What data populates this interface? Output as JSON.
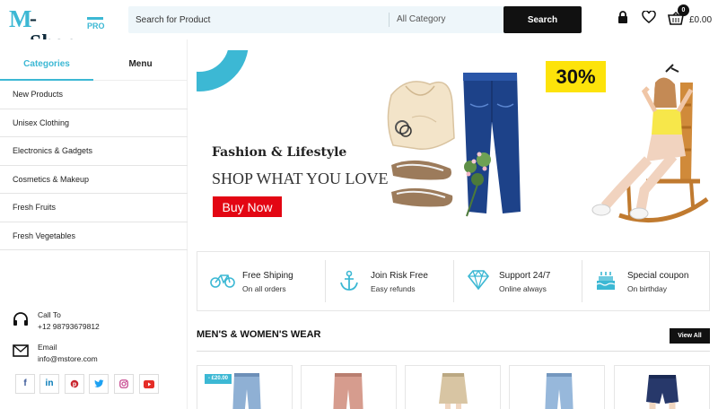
{
  "brand": {
    "logo_m": "M",
    "logo_shop": "-Shop",
    "logo_pro": "PRO"
  },
  "search": {
    "placeholder": "Search for Product",
    "category": "All Category",
    "button": "Search"
  },
  "header": {
    "cart_count": "0",
    "cart_total": "£0.00"
  },
  "sidebar": {
    "tabs": [
      {
        "label": "Categories"
      },
      {
        "label": "Menu"
      }
    ],
    "categories": [
      {
        "label": "New Products"
      },
      {
        "label": "Unisex Clothing"
      },
      {
        "label": "Electronics & Gadgets"
      },
      {
        "label": "Cosmetics & Makeup"
      },
      {
        "label": "Fresh Fruits"
      },
      {
        "label": "Fresh Vegetables"
      }
    ],
    "contact": {
      "call_title": "Call To",
      "call_value": "+12 98793679812",
      "email_title": "Email",
      "email_value": "info@mstore.com"
    },
    "socials": [
      "facebook",
      "linkedin",
      "pinterest",
      "twitter",
      "instagram",
      "youtube"
    ]
  },
  "banner": {
    "subtitle": "Fashion & Lifestyle",
    "title": "SHOP WHAT YOU LOVE",
    "button": "Buy Now",
    "side_badge": "30%"
  },
  "features": [
    {
      "icon": "bicycle-icon",
      "title": "Free Shiping",
      "sub": "On all orders"
    },
    {
      "icon": "anchor-icon",
      "title": "Join Risk Free",
      "sub": "Easy refunds"
    },
    {
      "icon": "diamond-icon",
      "title": "Support 24/7",
      "sub": "Online always"
    },
    {
      "icon": "cake-icon",
      "title": "Special coupon",
      "sub": "On birthday"
    }
  ],
  "section": {
    "title": "MEN'S & WOMEN'S WEAR",
    "view_all": "View All"
  },
  "products": [
    {
      "price": "- £20.00"
    }
  ],
  "colors": {
    "accent": "#3cb8d4",
    "dark": "#111111",
    "buy_now": "#e30613",
    "badge": "#fde30a"
  }
}
